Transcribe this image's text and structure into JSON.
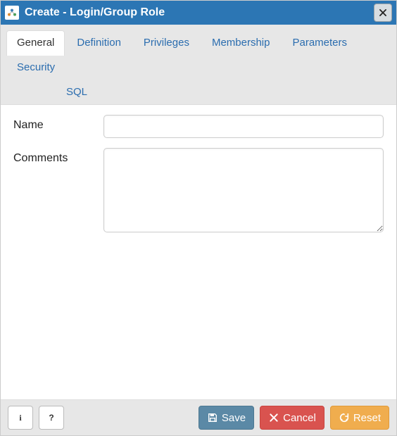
{
  "window": {
    "title": "Create - Login/Group Role"
  },
  "tabs": [
    {
      "label": "General",
      "active": true
    },
    {
      "label": "Definition",
      "active": false
    },
    {
      "label": "Privileges",
      "active": false
    },
    {
      "label": "Membership",
      "active": false
    },
    {
      "label": "Parameters",
      "active": false
    },
    {
      "label": "Security",
      "active": false
    },
    {
      "label": "SQL",
      "active": false
    }
  ],
  "form": {
    "name": {
      "label": "Name",
      "value": "",
      "placeholder": ""
    },
    "comments": {
      "label": "Comments",
      "value": "",
      "placeholder": ""
    }
  },
  "footer": {
    "info_tooltip": "i",
    "help_tooltip": "?",
    "save": "Save",
    "cancel": "Cancel",
    "reset": "Reset"
  },
  "colors": {
    "titlebar": "#2c76b4",
    "tab_link": "#2b6daf",
    "save": "#5b89a6",
    "cancel": "#d9534f",
    "reset": "#f0ad4e"
  }
}
